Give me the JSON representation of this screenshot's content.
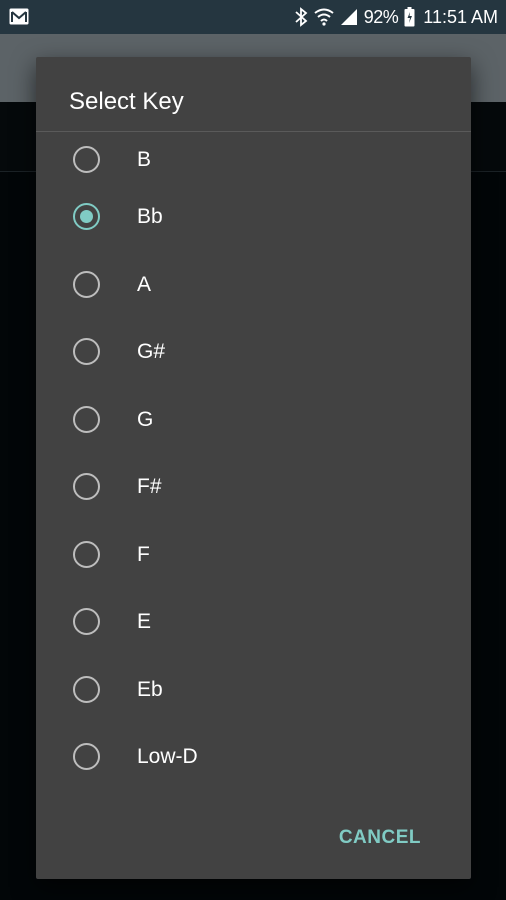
{
  "status_bar": {
    "battery_percent": "92%",
    "time": "11:51 AM"
  },
  "dialog": {
    "title": "Select Key",
    "options": [
      {
        "label": "B",
        "selected": false
      },
      {
        "label": "Bb",
        "selected": true
      },
      {
        "label": "A",
        "selected": false
      },
      {
        "label": "G#",
        "selected": false
      },
      {
        "label": "G",
        "selected": false
      },
      {
        "label": "F#",
        "selected": false
      },
      {
        "label": "F",
        "selected": false
      },
      {
        "label": "E",
        "selected": false
      },
      {
        "label": "Eb",
        "selected": false
      },
      {
        "label": "Low-D",
        "selected": false
      }
    ],
    "cancel_label": "CANCEL"
  },
  "colors": {
    "accent": "#80cbc4",
    "dialog_bg": "#424242",
    "status_bar_bg": "#253640"
  }
}
